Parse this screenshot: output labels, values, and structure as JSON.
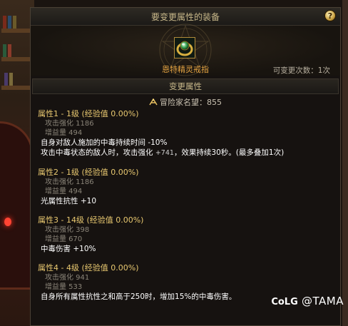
{
  "window": {
    "title": "要变更属性的装备",
    "help_label": "?"
  },
  "equipment": {
    "icon": "ring-icon",
    "name": "恩特精灵戒指",
    "change_count": "可变更次数：1次"
  },
  "section": {
    "title": "变更属性"
  },
  "fame": {
    "icon": "fame-icon",
    "text": "冒险家名望：855"
  },
  "properties": [
    {
      "title": "属性1 - 1级 (经验值 0.00%)",
      "stats": [
        "攻击强化 1186",
        "增益量 494"
      ],
      "effects": [
        {
          "pre": "自身对敌人施加的中毒持续时间 -10%",
          "num": "",
          "post": ""
        },
        {
          "pre": "攻击中毒状态的敌人时，攻击强化 ",
          "num": "+741",
          "post": "，效果持续30秒。(最多叠加1次)"
        }
      ]
    },
    {
      "title": "属性2 - 1级 (经验值 0.00%)",
      "stats": [
        "攻击强化 1186",
        "增益量 494"
      ],
      "effects": [
        {
          "pre": "光属性抗性 +10",
          "num": "",
          "post": ""
        }
      ]
    },
    {
      "title": "属性3 - 14级 (经验值 0.00%)",
      "stats": [
        "攻击强化 398",
        "增益量 670"
      ],
      "effects": [
        {
          "pre": "中毒伤害 +10%",
          "num": "",
          "post": ""
        }
      ]
    },
    {
      "title": "属性4 - 4级 (经验值 0.00%)",
      "stats": [
        "攻击强化 941",
        "增益量 533"
      ],
      "effects": [
        {
          "pre": "自身所有属性抗性之和高于250时，增加15%的中毒伤害。",
          "num": "",
          "post": ""
        }
      ]
    }
  ],
  "watermark": {
    "logo": "CoLG",
    "text": "@TAMA"
  }
}
